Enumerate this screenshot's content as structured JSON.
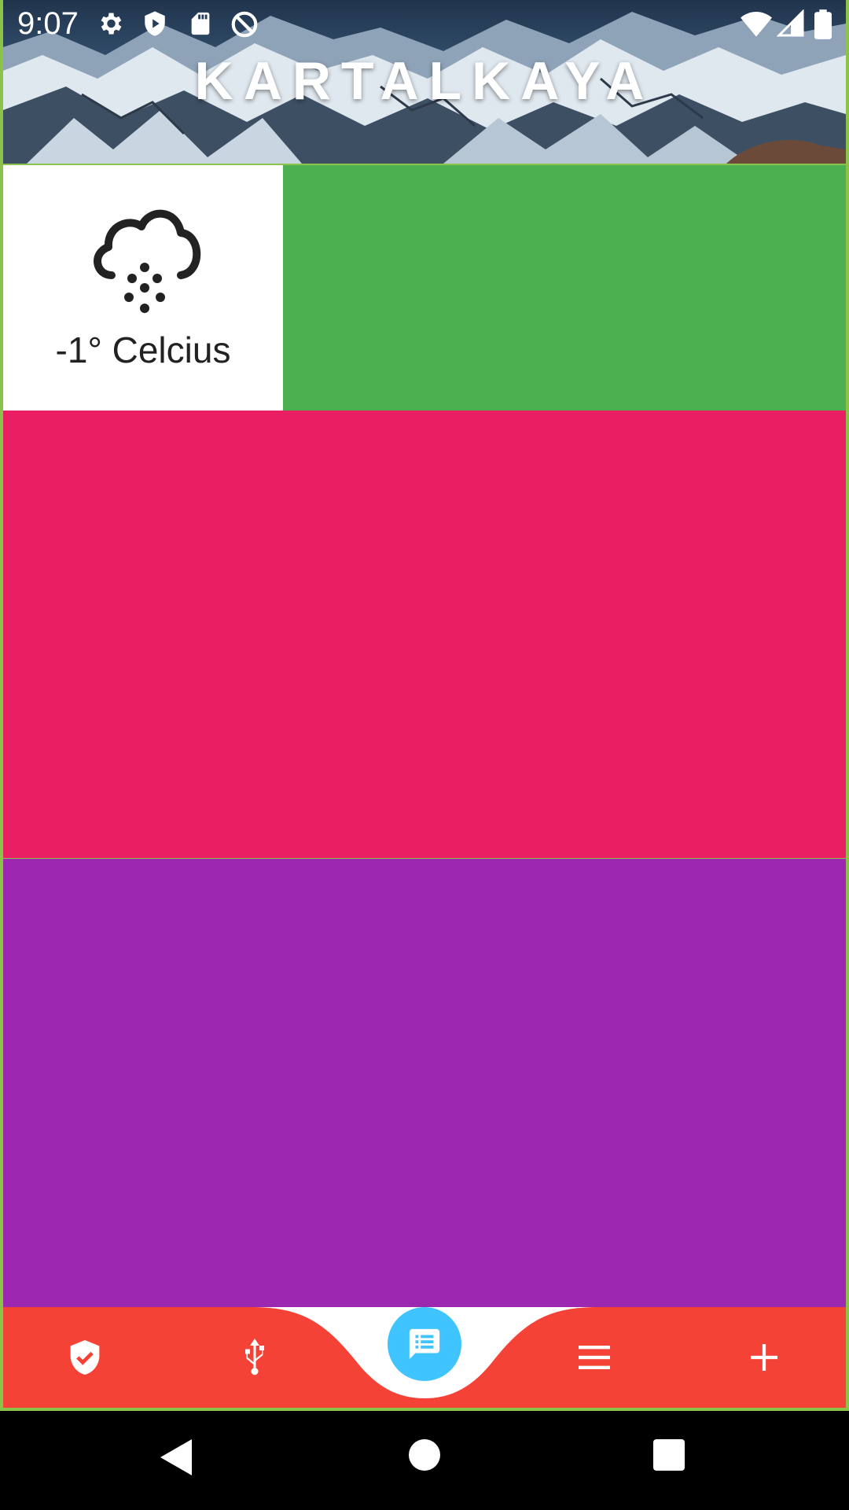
{
  "status_bar": {
    "time": "9:07",
    "icons": [
      "gear-icon",
      "play-store-icon",
      "sd-card-icon",
      "no-disturb-icon",
      "wifi-icon",
      "signal-icon",
      "battery-icon"
    ]
  },
  "header": {
    "title": "KARTALKAYA"
  },
  "weather": {
    "icon": "snow-cloud-icon",
    "temperature": "-1° Celcius"
  },
  "tiles": {
    "green_color": "#4caf50",
    "pink_color": "#e91e63",
    "purple_color": "#9c27b0"
  },
  "bottom_nav": {
    "background_color": "#f44336",
    "fab_color": "#40c4ff",
    "items": [
      "shield-check-icon",
      "usb-icon",
      "message-list-icon",
      "menu-icon",
      "add-icon"
    ]
  },
  "system_nav": {
    "buttons": [
      "back-icon",
      "home-icon",
      "recents-icon"
    ]
  }
}
